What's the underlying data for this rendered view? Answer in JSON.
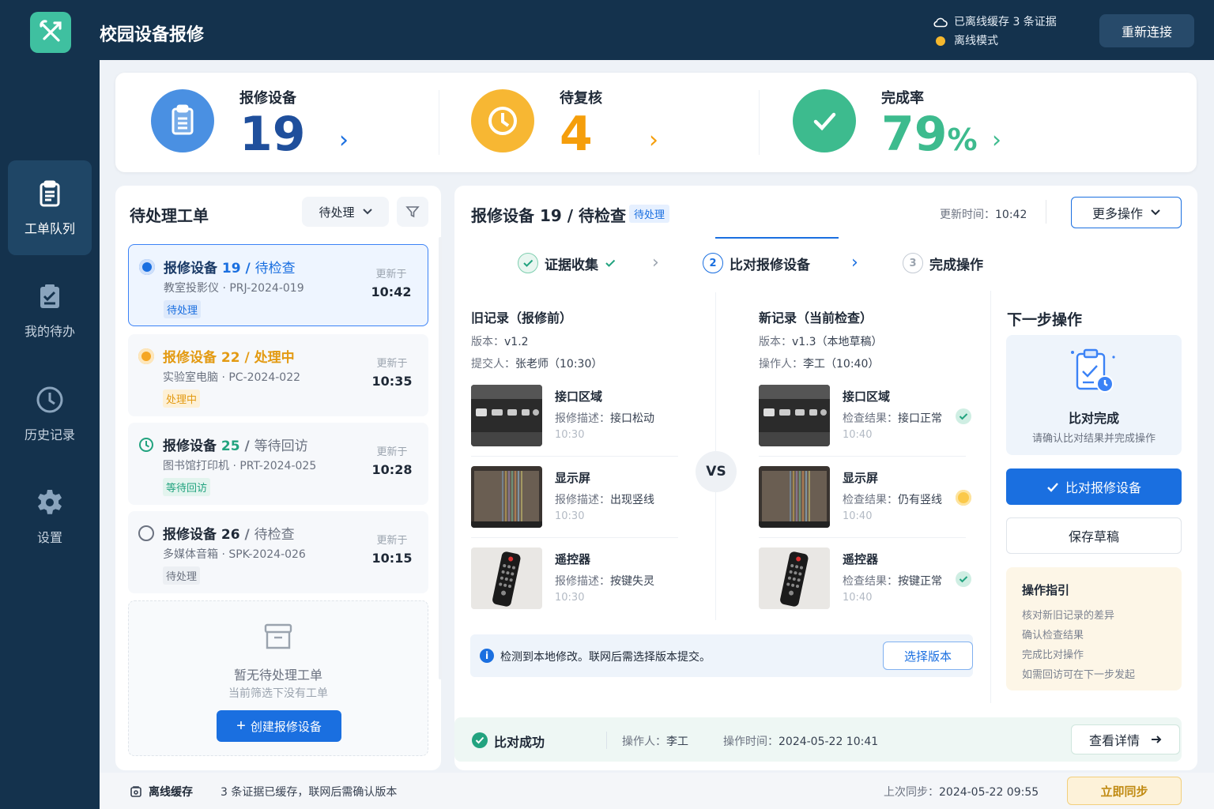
{
  "app": {
    "title": "校园设备报修"
  },
  "header": {
    "offline_cache": "已离线缓存 3 条证据",
    "offline_mode": "离线模式",
    "reconnect_label": "重新连接"
  },
  "sidebar": {
    "items": [
      {
        "label": "工单队列",
        "icon": "clipboard-icon",
        "active": true
      },
      {
        "label": "我的待办",
        "icon": "checklist-icon",
        "active": false
      },
      {
        "label": "历史记录",
        "icon": "clock-icon",
        "active": false
      },
      {
        "label": "设置",
        "icon": "gear-icon",
        "active": false
      }
    ]
  },
  "stats": [
    {
      "label": "报修设备",
      "value": "19",
      "unit": "",
      "color": "#4a90e2"
    },
    {
      "label": "待复核",
      "value": "4",
      "unit": "",
      "color": "#f5a623"
    },
    {
      "label": "完成率",
      "value": "79",
      "unit": "%",
      "color": "#3dbb8e"
    }
  ],
  "queue": {
    "title": "待处理工单",
    "filter_value": "待处理",
    "tickets": [
      {
        "name": "报修设备",
        "num": "19",
        "status_text": "待检查",
        "sub": "教室投影仪 · PRJ-2024-019",
        "badge": "待处理",
        "updated_label": "更新于",
        "time": "10:42",
        "color": "#1a6fe0"
      },
      {
        "name": "报修设备",
        "num": "22",
        "status_text": "处理中",
        "sub": "实验室电脑 · PC-2024-022",
        "badge": "处理中",
        "updated_label": "更新于",
        "time": "10:35",
        "color": "#e39a12"
      },
      {
        "name": "报修设备",
        "num": "25",
        "status_text": "等待回访",
        "sub": "图书馆打印机 · PRT-2024-025",
        "badge": "等待回访",
        "updated_label": "更新于",
        "time": "10:28",
        "color": "#22a37f"
      },
      {
        "name": "报修设备",
        "num": "26",
        "status_text": "待检查",
        "sub": "多媒体音箱 · SPK-2024-026",
        "badge": "待处理",
        "updated_label": "更新于",
        "time": "10:15",
        "color": "#6b7280"
      }
    ],
    "empty_title": "暂无待处理工单",
    "empty_sub": "当前筛选下没有工单",
    "create_label": "创建报修设备"
  },
  "detail": {
    "title": "报修设备 19 / 待检查",
    "badge": "待处理",
    "update_label": "更新时间：",
    "update_time": "10:42",
    "more_label": "更多操作",
    "steps": [
      {
        "num": "✓",
        "label": "证据收集",
        "state": "done"
      },
      {
        "num": "2",
        "label": "比对报修设备",
        "state": "active"
      },
      {
        "num": "3",
        "label": "完成操作",
        "state": "todo"
      }
    ],
    "old": {
      "title": "旧记录（报修前）",
      "version_label": "版本：",
      "version": "v1.2",
      "person_label": "提交人：",
      "person": "张老师（10:30）",
      "items": [
        {
          "name": "接口区域",
          "desc_label": "报修描述：",
          "desc": "接口松动",
          "time": "10:30"
        },
        {
          "name": "显示屏",
          "desc_label": "报修描述：",
          "desc": "出现竖线",
          "time": "10:30"
        },
        {
          "name": "遥控器",
          "desc_label": "报修描述：",
          "desc": "按键失灵",
          "time": "10:30"
        }
      ]
    },
    "vs": "VS",
    "new": {
      "title": "新记录（当前检查）",
      "version_label": "版本：",
      "version": "v1.3（本地草稿）",
      "person_label": "操作人：",
      "person": "李工（10:40）",
      "items": [
        {
          "name": "接口区域",
          "desc_label": "检查结果：",
          "desc": "接口正常",
          "time": "10:40",
          "result": "ok"
        },
        {
          "name": "显示屏",
          "desc_label": "检查结果：",
          "desc": "仍有竖线",
          "time": "10:40",
          "result": "warn"
        },
        {
          "name": "遥控器",
          "desc_label": "检查结果：",
          "desc": "按键正常",
          "time": "10:40",
          "result": "ok"
        }
      ]
    },
    "notice": "检测到本地修改。联网后需选择版本提交。",
    "select_version_label": "选择版本"
  },
  "next": {
    "title": "下一步操作",
    "card_title": "比对完成",
    "card_sub": "请确认比对结果并完成操作",
    "primary_label": "比对报修设备",
    "draft_label": "保存草稿",
    "guide_title": "操作指引",
    "guide_lines": [
      "核对新旧记录的差异",
      "确认检查结果",
      "完成比对操作",
      "如需回访可在下一步发起"
    ]
  },
  "success": {
    "title": "比对成功",
    "operator_label": "操作人：",
    "operator": "李工",
    "time_label": "操作时间：",
    "time": "2024-05-22 10:41",
    "view_label": "查看详情"
  },
  "footer": {
    "cache_label": "离线缓存",
    "message": "3 条证据已缓存，联网后需确认版本",
    "sync_label": "上次同步：",
    "sync_time": "2024-05-22 09:55",
    "sync_now_label": "立即同步"
  }
}
